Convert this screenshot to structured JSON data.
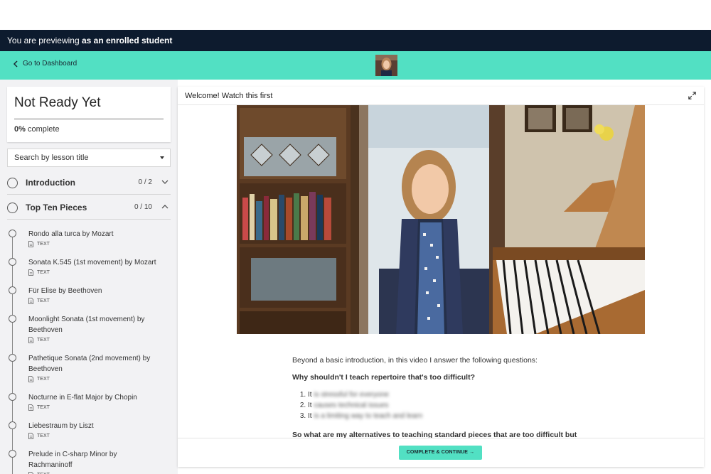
{
  "preview_bar": {
    "prefix": "You are previewing",
    "bold": "as an enrolled student"
  },
  "nav": {
    "back_label": "Go to Dashboard"
  },
  "sidebar": {
    "course_title": "Not Ready Yet",
    "progress_value": "0%",
    "progress_suffix": "complete",
    "progress_fraction": 0,
    "search_label": "Search by lesson title",
    "sections": [
      {
        "title": "Introduction",
        "count": "0 / 2",
        "expanded": false
      },
      {
        "title": "Top Ten Pieces",
        "count": "0 / 10",
        "expanded": true
      }
    ],
    "lessons": [
      {
        "title": "Rondo alla turca by Mozart",
        "type": "TEXT"
      },
      {
        "title": "Sonata K.545 (1st movement) by Mozart",
        "type": "TEXT"
      },
      {
        "title": "Für Elise by Beethoven",
        "type": "TEXT"
      },
      {
        "title": "Moonlight Sonata (1st movement) by Beethoven",
        "type": "TEXT"
      },
      {
        "title": "Pathetique Sonata (2nd movement) by Beethoven",
        "type": "TEXT"
      },
      {
        "title": "Nocturne in E-flat Major by Chopin",
        "type": "TEXT"
      },
      {
        "title": "Liebestraum by Liszt",
        "type": "TEXT"
      },
      {
        "title": "Prelude in C-sharp Minor by Rachmaninoff",
        "type": "TEXT"
      }
    ]
  },
  "main": {
    "lesson_title": "Welcome! Watch this first",
    "intro": "Beyond a basic introduction, in this video I answer the following questions:",
    "question1": "Why shouldn't I teach repertoire that's too difficult?",
    "answers": [
      {
        "visible": "It",
        "blurred": "is stressful for everyone"
      },
      {
        "visible": "It",
        "blurred": "causes technical issues"
      },
      {
        "visible": "It",
        "blurred": "is a limiting way to teach and learn"
      }
    ],
    "question2": "So what are my alternatives to teaching standard pieces that are too difficult but",
    "complete_label": "COMPLETE & CONTINUE →"
  },
  "colors": {
    "accent": "#52e0c3",
    "preview_bar": "#0d1b2e",
    "sidebar_bg": "#f2f2f4"
  }
}
